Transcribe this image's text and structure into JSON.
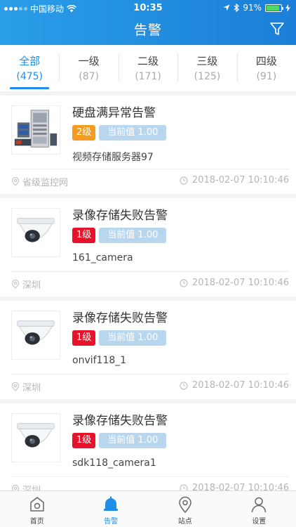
{
  "status_bar": {
    "carrier": "中国移动",
    "time": "10:35",
    "battery": "91%",
    "battery_level": 0.91
  },
  "nav": {
    "title": "告警"
  },
  "tabs": [
    {
      "label": "全部",
      "count": "(475)"
    },
    {
      "label": "一级",
      "count": "(87)"
    },
    {
      "label": "二级",
      "count": "(171)"
    },
    {
      "label": "三级",
      "count": "(125)"
    },
    {
      "label": "四级",
      "count": "(91)"
    }
  ],
  "alarms": [
    {
      "title": "硬盘满异常告警",
      "level": "2级",
      "current": "当前值 1.00",
      "source": "视频存储服务器97",
      "location": "省级监控网",
      "time": "2018-02-07 10:10:46"
    },
    {
      "title": "录像存储失败告警",
      "level": "1级",
      "current": "当前值 1.00",
      "source": "161_camera",
      "location": "深圳",
      "time": "2018-02-07 10:10:46"
    },
    {
      "title": "录像存储失败告警",
      "level": "1级",
      "current": "当前值 1.00",
      "source": "onvif118_1",
      "location": "深圳",
      "time": "2018-02-07 10:10:46"
    },
    {
      "title": "录像存储失败告警",
      "level": "1级",
      "current": "当前值 1.00",
      "source": "sdk118_camera1",
      "location": "深圳",
      "time": "2018-02-07 10:10:46"
    }
  ],
  "tabbar": [
    {
      "label": "首页",
      "icon": "home-icon"
    },
    {
      "label": "告警",
      "icon": "bell-icon"
    },
    {
      "label": "站点",
      "icon": "location-pin-icon"
    },
    {
      "label": "设置",
      "icon": "user-icon"
    }
  ],
  "colors": {
    "primary": "#1f8ee6",
    "level1": "#e8132b",
    "level2": "#f39c1f",
    "current_badge": "#b8d7ef"
  }
}
